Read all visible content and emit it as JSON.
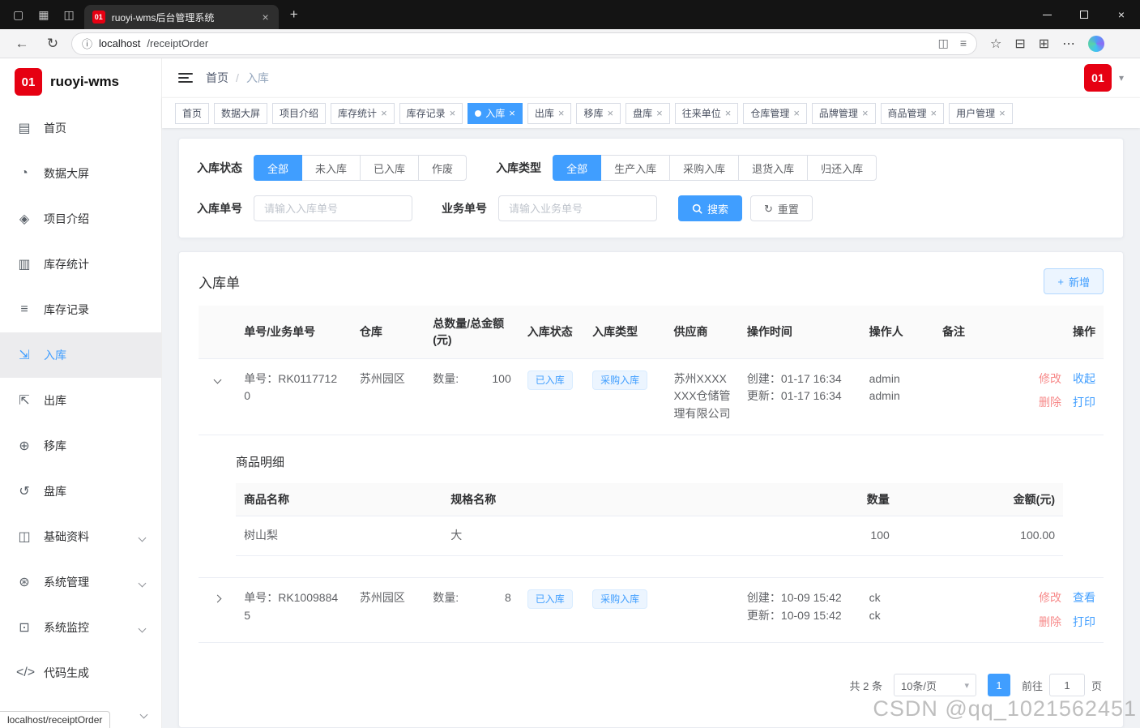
{
  "colors": {
    "primary": "#409eff",
    "danger_link": "#f78989",
    "brand_red": "#e60012",
    "tag_bg": "#ecf5ff",
    "tag_border": "#d9ecff"
  },
  "icons": {
    "back": "←",
    "refresh": "↻",
    "info": "ⓘ",
    "split_screen": "◫",
    "reading_mode": "≡",
    "favorite_star": "☆",
    "collections": "⊟",
    "extensions": "⊞",
    "more": "⋯",
    "close": "×",
    "new_tab": "+",
    "plus": "+",
    "caret_down": "▾",
    "workspaces": "▦",
    "tab_groups": "◫",
    "vertical_tabs": "▢"
  },
  "browser": {
    "tab_title": "ruoyi-wms后台管理系统",
    "favicon": "01",
    "url_host": "localhost",
    "url_path": "/receiptOrder",
    "status_tooltip": "localhost/receiptOrder"
  },
  "app": {
    "logo_badge": "01",
    "logo_name": "ruoyi-wms",
    "breadcrumb": [
      "首页",
      "入库"
    ],
    "breadcrumb_sep": "/",
    "avatar_text": "01",
    "tags": [
      {
        "label": "首页"
      },
      {
        "label": "数据大屏"
      },
      {
        "label": "项目介绍"
      },
      {
        "label": "库存统计"
      },
      {
        "label": "库存记录"
      },
      {
        "label": "入库"
      },
      {
        "label": "出库"
      },
      {
        "label": "移库"
      },
      {
        "label": "盘库"
      },
      {
        "label": "往来单位"
      },
      {
        "label": "仓库管理"
      },
      {
        "label": "品牌管理"
      },
      {
        "label": "商品管理"
      },
      {
        "label": "用户管理"
      }
    ],
    "sidebar": [
      {
        "label": "首页",
        "icon": "▤"
      },
      {
        "label": "数据大屏",
        "icon": "◔"
      },
      {
        "label": "项目介绍",
        "icon": "◈"
      },
      {
        "label": "库存统计",
        "icon": "▥"
      },
      {
        "label": "库存记录",
        "icon": "≡"
      },
      {
        "label": "入库",
        "icon": "⇲"
      },
      {
        "label": "出库",
        "icon": "⇱"
      },
      {
        "label": "移库",
        "icon": "⊕"
      },
      {
        "label": "盘库",
        "icon": "↺"
      },
      {
        "label": "基础资料",
        "icon": "◫"
      },
      {
        "label": "系统管理",
        "icon": "⊛"
      },
      {
        "label": "系统监控",
        "icon": "⊡"
      },
      {
        "label": "代码生成",
        "icon": "</>"
      }
    ]
  },
  "filter": {
    "status_label": "入库状态",
    "status_options": [
      "全部",
      "未入库",
      "已入库",
      "作废"
    ],
    "type_label": "入库类型",
    "type_options": [
      "全部",
      "生产入库",
      "采购入库",
      "退货入库",
      "归还入库"
    ],
    "order_no_label": "入库单号",
    "order_no_placeholder": "请输入入库单号",
    "biz_no_label": "业务单号",
    "biz_no_placeholder": "请输入业务单号",
    "search_label": "搜索",
    "reset_label": "重置"
  },
  "panel": {
    "title": "入库单",
    "add_label": "新增",
    "columns": [
      "单号/业务单号",
      "仓库",
      "总数量/总金额(元)",
      "入库状态",
      "入库类型",
      "供应商",
      "操作时间",
      "操作人",
      "备注",
      "操作"
    ],
    "rows": [
      {
        "order_no": "单号：RK01177120",
        "warehouse": "苏州园区",
        "qty_label": "数量:",
        "qty_value": "100",
        "status": "已入库",
        "type": "采购入库",
        "supplier": "苏州XXXXXXX仓储管理有限公司",
        "created": "创建：01-17 16:34",
        "updated": "更新：01-17 16:34",
        "operator_line1": "admin",
        "operator_line2": "admin",
        "action1": "修改",
        "action2": "收起",
        "action3": "删除",
        "action4": "打印"
      },
      {
        "order_no": "单号：RK10098845",
        "warehouse": "苏州园区",
        "qty_label": "数量:",
        "qty_value": "8",
        "status": "已入库",
        "type": "采购入库",
        "supplier": "",
        "created": "创建：10-09 15:42",
        "updated": "更新：10-09 15:42",
        "operator_line1": "ck",
        "operator_line2": "ck",
        "action1": "修改",
        "action2": "查看",
        "action3": "删除",
        "action4": "打印"
      }
    ],
    "detail": {
      "title": "商品明细",
      "columns": [
        "商品名称",
        "规格名称",
        "数量",
        "金额(元)"
      ],
      "rows": [
        {
          "name": "树山梨",
          "spec": "大",
          "qty": "100",
          "amount": "100.00"
        }
      ]
    },
    "pagination": {
      "total": "共 2 条",
      "page_size": "10条/页",
      "page": "1",
      "goto_label": "前往",
      "goto_value": "1",
      "goto_unit": "页"
    }
  },
  "watermark": "CSDN @qq_1021562451"
}
